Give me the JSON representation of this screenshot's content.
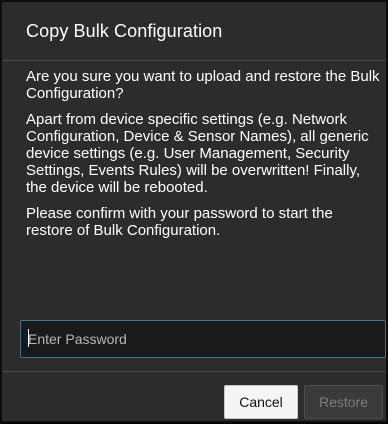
{
  "dialog": {
    "title": "Copy Bulk Configuration",
    "paragraphs": [
      "Are you sure you want to upload and restore the Bulk Configuration?",
      "Apart from device specific settings (e.g. Network Configuration, Device & Sensor Names), all generic device settings (e.g. User Management, Security Settings, Events Rules) will be overwritten! Finally, the device will be rebooted.",
      "Please confirm with your password to start the restore of Bulk Configuration."
    ],
    "password": {
      "placeholder": "Enter Password",
      "value": ""
    },
    "buttons": {
      "cancel_label": "Cancel",
      "restore_label": "Restore",
      "restore_disabled": true
    }
  },
  "colors": {
    "dialog_background": "#2c2c2c",
    "text": "#ffffff",
    "input_border_focus": "#3e6f95",
    "cancel_background": "#f5f5f5",
    "restore_disabled_text": "#7d7d7d"
  }
}
